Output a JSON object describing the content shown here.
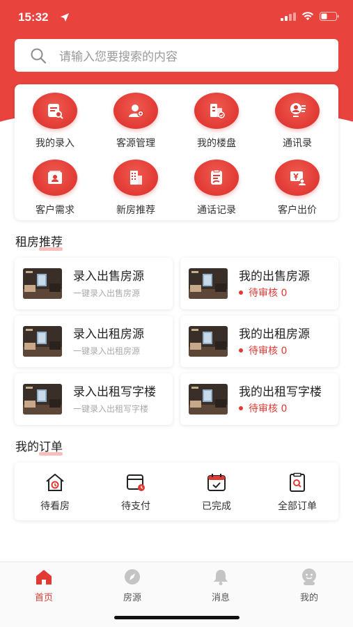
{
  "status_bar": {
    "time": "15:32"
  },
  "search": {
    "placeholder": "请输入您要搜索的内容"
  },
  "quick_actions": [
    {
      "label": "我的录入",
      "icon": "document-search-icon"
    },
    {
      "label": "客源管理",
      "icon": "user-gear-icon"
    },
    {
      "label": "我的楼盘",
      "icon": "building-check-icon"
    },
    {
      "label": "通讯录",
      "icon": "contacts-icon"
    },
    {
      "label": "客户需求",
      "icon": "customer-folder-icon"
    },
    {
      "label": "新房推荐",
      "icon": "new-building-icon"
    },
    {
      "label": "通话记录",
      "icon": "call-log-icon"
    },
    {
      "label": "客户出价",
      "icon": "price-offer-icon"
    }
  ],
  "rent_section": {
    "title_prefix": "租房",
    "title_highlight": "推荐",
    "tiles": [
      {
        "title": "录入出售房源",
        "subtitle": "一键录入出售房源"
      },
      {
        "title": "我的出售房源",
        "status": "待审核 0"
      },
      {
        "title": "录入出租房源",
        "subtitle": "一键录入出租房源"
      },
      {
        "title": "我的出租房源",
        "status": "待审核 0"
      },
      {
        "title": "录入出租写字楼",
        "subtitle": "一键录入出租写字楼"
      },
      {
        "title": "我的出租写字楼",
        "status": "待审核 0"
      }
    ]
  },
  "orders_section": {
    "title_prefix": "我的",
    "title_highlight": "订单",
    "items": [
      {
        "label": "待看房",
        "icon": "house-clock-icon"
      },
      {
        "label": "待支付",
        "icon": "wallet-clock-icon"
      },
      {
        "label": "已完成",
        "icon": "calendar-check-icon"
      },
      {
        "label": "全部订单",
        "icon": "order-search-icon"
      }
    ]
  },
  "tabbar": [
    {
      "label": "首页",
      "icon": "home-icon",
      "active": true
    },
    {
      "label": "房源",
      "icon": "compass-icon",
      "active": false
    },
    {
      "label": "消息",
      "icon": "bell-icon",
      "active": false
    },
    {
      "label": "我的",
      "icon": "profile-icon",
      "active": false
    }
  ],
  "colors": {
    "brand_red": "#e13a34",
    "header_red": "#e8433d",
    "muted_text": "#9a9a9a"
  }
}
